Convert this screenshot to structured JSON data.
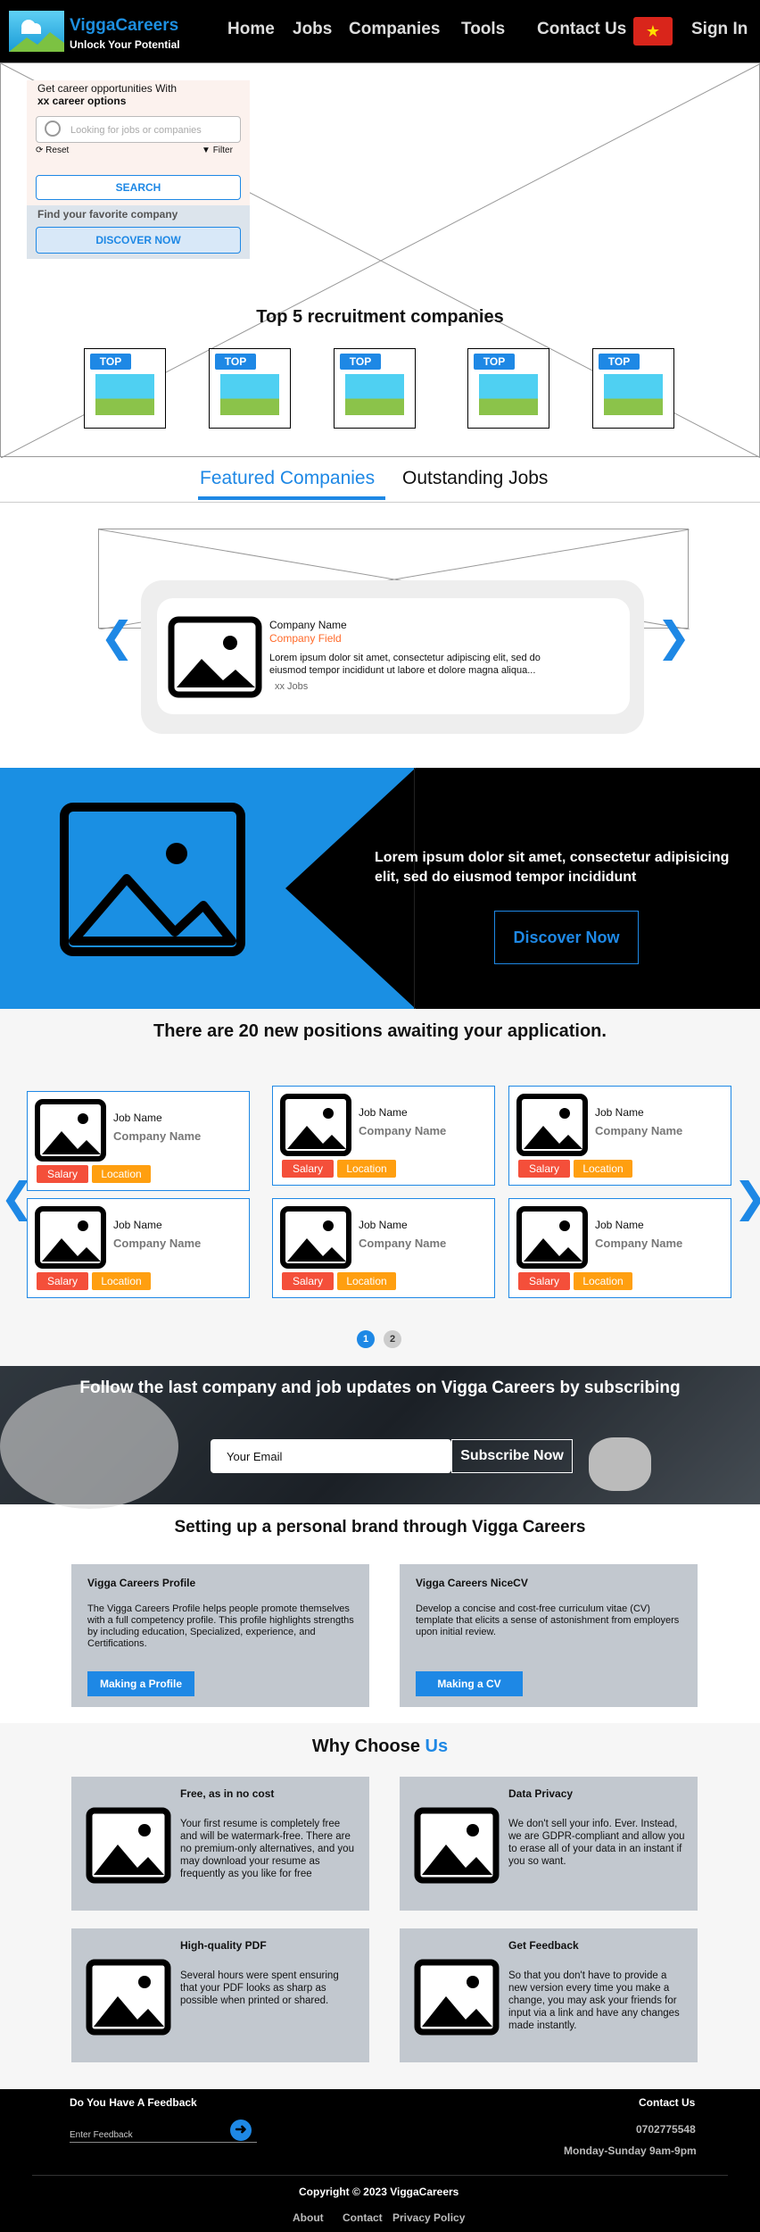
{
  "header": {
    "brand": "ViggaCareers",
    "tagline": "Unlock Your Potential",
    "nav": [
      "Home",
      "Jobs",
      "Companies",
      "Tools",
      "Contact Us"
    ],
    "sign_in": "Sign In",
    "flag_icon": "vietnam-flag-icon"
  },
  "hero": {
    "panel_line1": "Get career opportunities With",
    "panel_line2": "xx career options",
    "search_placeholder": "Looking for jobs or companies",
    "reset": "Reset",
    "filter": "Filter",
    "search_button": "SEARCH",
    "fav_label": "Find your favorite company",
    "discover_button": "DISCOVER NOW",
    "top5_title": "Top 5 recruitment companies",
    "top_tag": "TOP"
  },
  "tabs": {
    "featured": "Featured Companies",
    "outstanding": "Outstanding Jobs"
  },
  "featured": {
    "company_name": "Company Name",
    "company_field": "Company Field",
    "description": "Lorem ipsum dolor sit amet, consectetur adipiscing elit, sed do eiusmod tempor incididunt ut labore et dolore magna aliqua...",
    "jobs": "xx Jobs"
  },
  "promo": {
    "text": "Lorem ipsum dolor sit amet, consectetur adipisicing elit, sed do eiusmod tempor incididunt",
    "button": "Discover Now"
  },
  "jobs": {
    "title": "There are 20 new positions awaiting your application.",
    "job_name": "Job Name",
    "company_name": "Company Name",
    "salary": "Salary",
    "location": "Location",
    "pages": [
      "1",
      "2"
    ]
  },
  "subscribe": {
    "title": "Follow the last company and job updates on Vigga Careers by subscribing",
    "placeholder": "Your Email",
    "button": "Subscribe Now"
  },
  "brand": {
    "title": "Setting up a personal brand through Vigga Careers",
    "cards": [
      {
        "title": "Vigga Careers Profile",
        "desc": "The Vigga Careers Profile helps people promote themselves with a full competency profile. This profile highlights strengths by including education, Specialized, experience, and Certifications.",
        "button": "Making a Profile"
      },
      {
        "title": "Vigga Careers NiceCV",
        "desc": "Develop a concise and cost-free curriculum vitae (CV) template that elicits a sense of astonishment from employers upon initial review.",
        "button": "Making a CV"
      }
    ]
  },
  "why": {
    "title_prefix": "Why Choose ",
    "title_accent": "Us",
    "cards": [
      {
        "title": "Free, as in no cost",
        "desc": "Your first resume is completely free and will be watermark-free. There are no premium-only alternatives, and you may download your resume as frequently as you like for free"
      },
      {
        "title": "Data Privacy",
        "desc": "We don't sell your info. Ever. Instead, we are GDPR-compliant and allow you to erase all of your data in an instant if you so want."
      },
      {
        "title": "High-quality PDF",
        "desc": "Several hours were spent ensuring that your PDF looks as sharp as possible when printed or shared."
      },
      {
        "title": "Get Feedback",
        "desc": "So that you don't have to provide a new version every time you make a change, you may ask your friends for input via a link and have any changes made instantly."
      }
    ]
  },
  "footer": {
    "feedback_title": "Do You Have A Feedback",
    "feedback_placeholder": "Enter Feedback",
    "contact_title": "Contact Us",
    "phone": "0702775548",
    "hours": "Monday-Sunday 9am-9pm",
    "copyright": "Copyright © 2023 ViggaCareers",
    "links": [
      "About",
      "Contact",
      "Privacy Policy"
    ]
  }
}
